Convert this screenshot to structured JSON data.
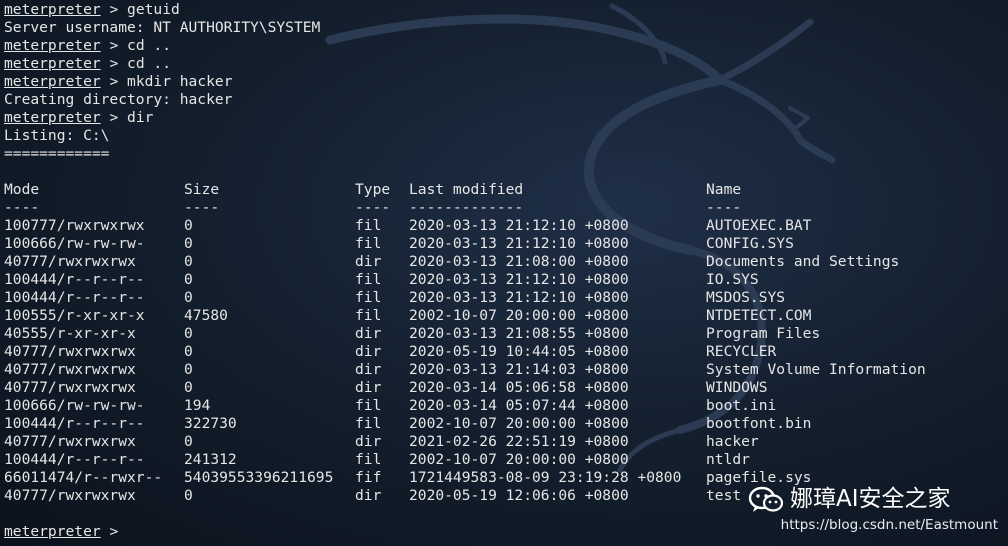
{
  "prompt_label": "meterpreter",
  "prompt_symbol": ">",
  "session_lines": [
    {
      "type": "cmd",
      "command": "getuid"
    },
    {
      "type": "out",
      "text": "Server username: NT AUTHORITY\\SYSTEM"
    },
    {
      "type": "cmd",
      "command": "cd .."
    },
    {
      "type": "cmd",
      "command": "cd .."
    },
    {
      "type": "cmd",
      "command": "mkdir hacker"
    },
    {
      "type": "out",
      "text": "Creating directory: hacker"
    },
    {
      "type": "cmd",
      "command": "dir"
    },
    {
      "type": "out",
      "text": "Listing: C:\\"
    },
    {
      "type": "out",
      "text": "============"
    },
    {
      "type": "out",
      "text": ""
    }
  ],
  "listing": {
    "headers": [
      "Mode",
      "Size",
      "Type",
      "Last modified",
      "Name"
    ],
    "separators": [
      "----",
      "----",
      "----",
      "-------------",
      "----"
    ],
    "rows": [
      [
        "100777/rwxrwxrwx",
        "0",
        "fil",
        "2020-03-13 21:12:10 +0800",
        "AUTOEXEC.BAT"
      ],
      [
        "100666/rw-rw-rw-",
        "0",
        "fil",
        "2020-03-13 21:12:10 +0800",
        "CONFIG.SYS"
      ],
      [
        "40777/rwxrwxrwx",
        "0",
        "dir",
        "2020-03-13 21:08:00 +0800",
        "Documents and Settings"
      ],
      [
        "100444/r--r--r--",
        "0",
        "fil",
        "2020-03-13 21:12:10 +0800",
        "IO.SYS"
      ],
      [
        "100444/r--r--r--",
        "0",
        "fil",
        "2020-03-13 21:12:10 +0800",
        "MSDOS.SYS"
      ],
      [
        "100555/r-xr-xr-x",
        "47580",
        "fil",
        "2002-10-07 20:00:00 +0800",
        "NTDETECT.COM"
      ],
      [
        "40555/r-xr-xr-x",
        "0",
        "dir",
        "2020-03-13 21:08:55 +0800",
        "Program Files"
      ],
      [
        "40777/rwxrwxrwx",
        "0",
        "dir",
        "2020-05-19 10:44:05 +0800",
        "RECYCLER"
      ],
      [
        "40777/rwxrwxrwx",
        "0",
        "dir",
        "2020-03-13 21:14:03 +0800",
        "System Volume Information"
      ],
      [
        "40777/rwxrwxrwx",
        "0",
        "dir",
        "2020-03-14 05:06:58 +0800",
        "WINDOWS"
      ],
      [
        "100666/rw-rw-rw-",
        "194",
        "fil",
        "2020-03-14 05:07:44 +0800",
        "boot.ini"
      ],
      [
        "100444/r--r--r--",
        "322730",
        "fil",
        "2002-10-07 20:00:00 +0800",
        "bootfont.bin"
      ],
      [
        "40777/rwxrwxrwx",
        "0",
        "dir",
        "2021-02-26 22:51:19 +0800",
        "hacker"
      ],
      [
        "100444/r--r--r--",
        "241312",
        "fil",
        "2002-10-07 20:00:00 +0800",
        "ntldr"
      ],
      [
        "66011474/r--rwxr--",
        "54039553396211695",
        "fif",
        "1721449583-08-09 23:19:28 +0800",
        "pagefile.sys"
      ],
      [
        "40777/rwxrwxrwx",
        "0",
        "dir",
        "2020-05-19 12:06:06 +0800",
        "test"
      ]
    ]
  },
  "final_prompt": {
    "command": ""
  },
  "watermark": {
    "title": "娜璋AI安全之家",
    "url": "https://blog.csdn.net/Eastmount",
    "logo_icon": "wechat-icon"
  },
  "colors": {
    "text": "#e6e6e6",
    "background": "#14202f",
    "dragon": "#2a3a52"
  }
}
